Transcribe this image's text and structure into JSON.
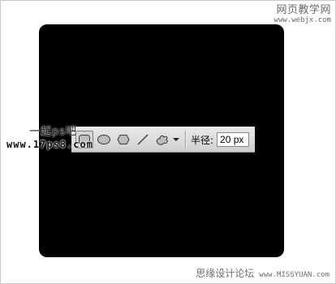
{
  "watermarks": {
    "top_cn": "网页教学网",
    "top_url": "www.webjx.com",
    "side_cn": "一起ps吧",
    "side_url": "www.17ps8.com",
    "bottom_cn": "思缘设计论坛",
    "bottom_url": "www.MISSYUAN.com"
  },
  "toolbar": {
    "tools": [
      {
        "name": "rounded-rectangle-tool",
        "icon": "rounded-rectangle-icon",
        "active": true
      },
      {
        "name": "ellipse-tool",
        "icon": "ellipse-icon",
        "active": false
      },
      {
        "name": "polygon-tool",
        "icon": "hexagon-icon",
        "active": false
      },
      {
        "name": "line-tool",
        "icon": "line-icon",
        "active": false
      },
      {
        "name": "custom-shape-tool",
        "icon": "custom-shape-icon",
        "active": false
      }
    ],
    "radius_label": "半径:",
    "radius_value": "20 px"
  },
  "colors": {
    "canvas": "#000000",
    "toolbar_bg": "#dcdcdc"
  }
}
